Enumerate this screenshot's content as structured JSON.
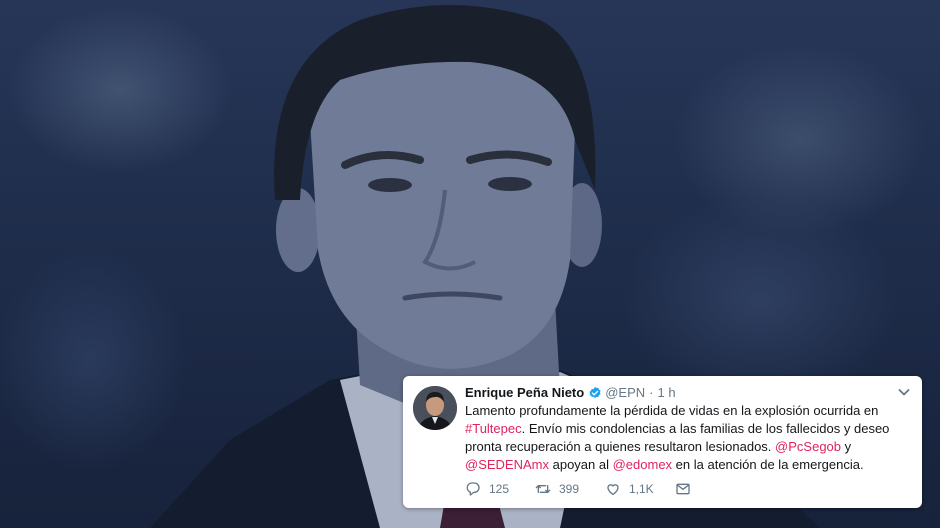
{
  "tweet": {
    "author_name": "Enrique Peña Nieto",
    "handle": "@EPN",
    "separator": "·",
    "time": "1 h",
    "text_1": "Lamento profundamente la pérdida de vidas en la explosión ocurrida en",
    "hashtag": "#Tultepec",
    "text_2": ". Envío mis condolencias a las familias de los fallecidos y deseo pronta recuperación a quienes resultaron lesionados. ",
    "mention_1": "@PcSegob",
    "text_3": " y ",
    "mention_2": "@SEDENAmx",
    "text_4": " apoyan al ",
    "mention_3": "@edomex",
    "text_5": " en la atención de la emergencia.",
    "replies": "125",
    "retweets": "399",
    "likes": "1,1K"
  },
  "colors": {
    "link": "#e0245e",
    "verified": "#1da1f2",
    "muted": "#657786",
    "overlay": "#1c2a46"
  },
  "icons": [
    "verified-badge-icon",
    "chevron-down-icon",
    "reply-icon",
    "retweet-icon",
    "like-icon",
    "message-icon"
  ]
}
